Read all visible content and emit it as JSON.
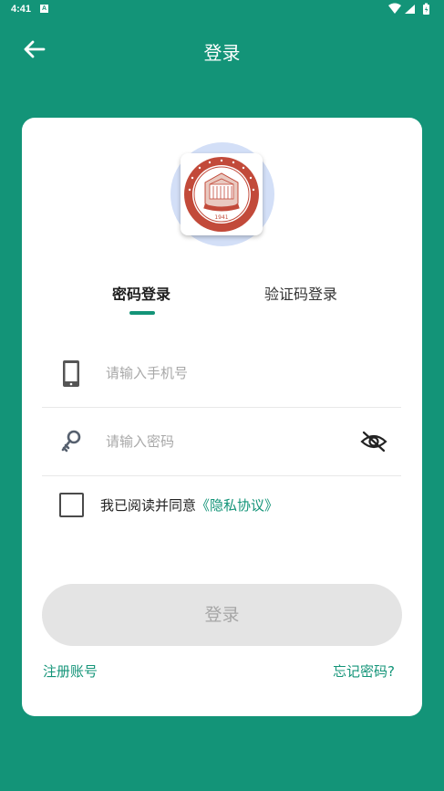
{
  "status_bar": {
    "time": "4:41",
    "notification_badge": "A",
    "icons": [
      "wifi-icon",
      "signal-icon",
      "battery-icon"
    ]
  },
  "app_bar": {
    "title": "登录",
    "back_icon": "arrow-left-icon"
  },
  "logo": {
    "emblem_year": "1941",
    "emblem_icon": "university-emblem-icon"
  },
  "tabs": [
    {
      "label": "密码登录",
      "active": true
    },
    {
      "label": "验证码登录",
      "active": false
    }
  ],
  "form": {
    "phone": {
      "placeholder": "请输入手机号",
      "value": "",
      "icon": "phone-icon"
    },
    "password": {
      "placeholder": "请输入密码",
      "value": "",
      "icon": "key-icon",
      "toggle_icon": "eye-off-icon"
    }
  },
  "agreement": {
    "checked": false,
    "prefix": "我已阅读并同意",
    "link": "《隐私协议》"
  },
  "login_button": "登录",
  "register_link": "注册账号",
  "forgot_link": "忘记密码?",
  "colors": {
    "primary": "#139478",
    "background": "#139478",
    "card": "#ffffff",
    "button_disabled_bg": "#e4e4e4",
    "button_disabled_text": "#a6a6a6",
    "logo_circle": "#d3dff7",
    "emblem": "#c24a3a"
  }
}
